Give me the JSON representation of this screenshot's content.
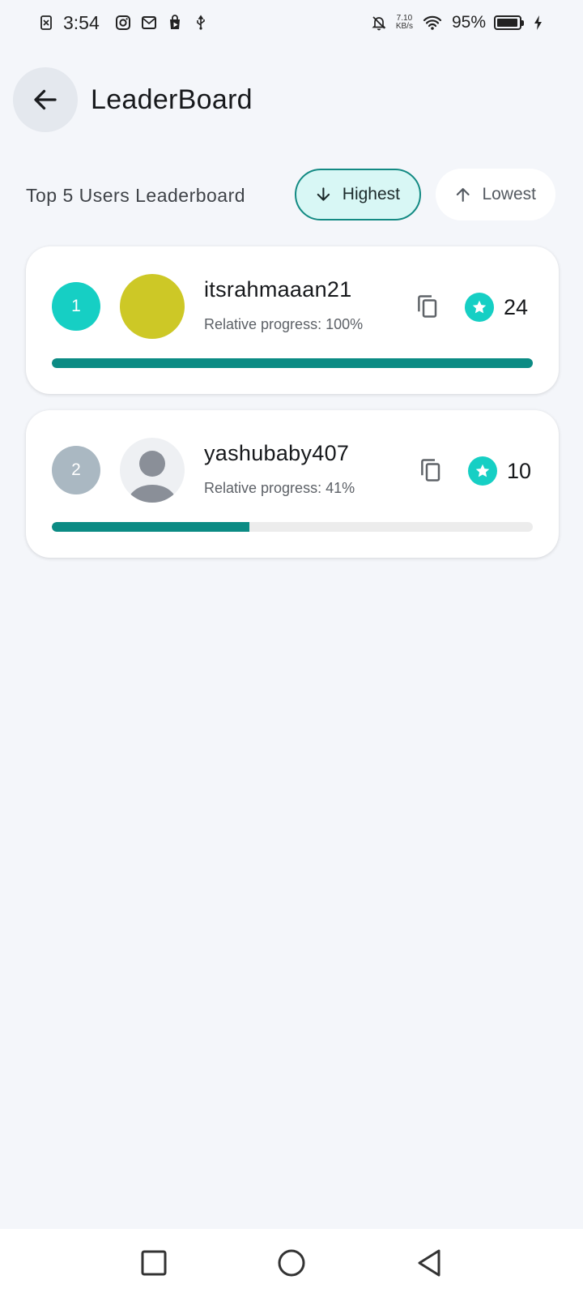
{
  "status_bar": {
    "time": "3:54",
    "net_speed_value": "7.10",
    "net_speed_unit": "KB/s",
    "battery_percent": "95%"
  },
  "header": {
    "title": "LeaderBoard"
  },
  "filter": {
    "subtitle": "Top 5 Users Leaderboard",
    "highest_label": "Highest",
    "lowest_label": "Lowest",
    "selected": "Highest"
  },
  "colors": {
    "accent": "#16cfc4",
    "progress_fill": "#0b8b84",
    "rank_1": "#16cfc4",
    "rank_2": "#aab8c2",
    "avatar_1": "#cdc826"
  },
  "users": [
    {
      "rank": "1",
      "username": "itsrahmaaan21",
      "progress_text": "Relative progress: 100%",
      "progress": 1.0,
      "score": "24",
      "avatar": "solid-color"
    },
    {
      "rank": "2",
      "username": "yashubaby407",
      "progress_text": "Relative progress: 41%",
      "progress": 0.41,
      "score": "10",
      "avatar": "default-person-icon"
    }
  ]
}
